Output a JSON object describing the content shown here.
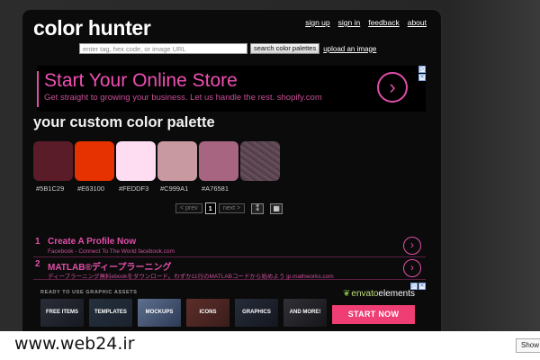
{
  "header": {
    "title": "color hunter",
    "links": [
      "sign up",
      "sign in",
      "feedback",
      "about"
    ]
  },
  "search": {
    "placeholder": "enter tag, hex code, or image URL",
    "button_label": "search color palettes",
    "upload_link": "upload an image"
  },
  "ad_banner": {
    "headline": "Start Your Online Store",
    "subtext": "Get straight to growing your business. Let us handle the rest. shopify.com",
    "arrow": "›",
    "corner_icons": [
      "▷",
      "✕"
    ]
  },
  "palette": {
    "title": "your custom color palette",
    "swatches": [
      {
        "hex": "#5B1C29",
        "color": "#5B1C29"
      },
      {
        "hex": "#E63100",
        "color": "#E63100"
      },
      {
        "hex": "#FEDDF3",
        "color": "#FEDDF3"
      },
      {
        "hex": "#C999A1",
        "color": "#C999A1"
      },
      {
        "hex": "#A76581",
        "color": "#A76581"
      }
    ]
  },
  "pager": {
    "prev": "< prev",
    "current": "1",
    "next": "next >",
    "icon1": "⁑",
    "icon2": "▦"
  },
  "text_ads": [
    {
      "num": "1",
      "title": "Create A Profile Now",
      "desc": "Facebook - Connect To The World facebook.com",
      "go": "›"
    },
    {
      "num": "2",
      "title": "MATLAB®ディープラーニング",
      "desc": "ディープラーニング無料ebookをダウンロード。わずか11行のMATLABコードから始めよう jp.mathworks.com",
      "go": "›"
    }
  ],
  "assets_ad": {
    "label": "READY TO USE GRAPHIC ASSETS",
    "tiles": [
      "FREE ITEMS",
      "TEMPLATES",
      "MOCKUPS",
      "ICONS",
      "GRAPHICS",
      "AND MORE!"
    ],
    "brand_a": "envato",
    "brand_b": "elements",
    "leaf": "❦",
    "cta": "START NOW"
  },
  "watermark": "www.web24.ir",
  "show_button": "Show"
}
